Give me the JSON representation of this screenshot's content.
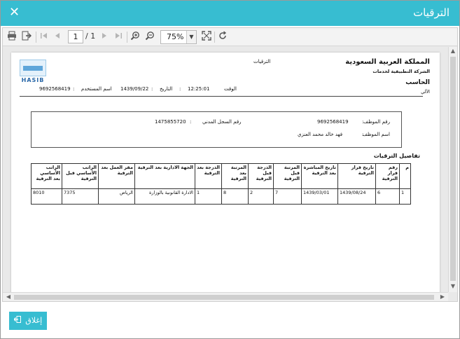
{
  "window": {
    "title": "الترقيات",
    "close_glyph": "✕"
  },
  "toolbar": {
    "print_icon": "print-icon",
    "export_icon": "export-icon",
    "page_current": "1",
    "page_total": "/ 1",
    "zoom": "75%"
  },
  "report": {
    "title": "الترقيات",
    "org_name": "المملكة العربية السعودية",
    "org_sub": "الشركة التطبيقية لخدمات",
    "org_name2": "الحاسب",
    "org_line3": "الآلي",
    "logo_text": "HASIB",
    "time_label": "الوقت",
    "time_value": "12:25:01",
    "date_label": "التاريخ",
    "date_value": "1439/09/22",
    "user_label": "اسم المستخدم",
    "user_value": "9692568419",
    "colon": ":"
  },
  "employee": {
    "emp_no_label": "رقم الموظف",
    "emp_no_value": "9692568419",
    "civil_label": "رقم السجل المدني",
    "civil_value": "1475855720",
    "name_label": "اسم الموظف",
    "name_value": "فهد خالد محمد العنزي"
  },
  "details": {
    "section_title": "تفاصيل الترقيات",
    "headers": [
      "م",
      "رقم قرار الترقية",
      "تاريخ قرار الترقية",
      "تاريخ المباشرة بعد الترقية",
      "المرتبة قبل الترقية",
      "الدرجة قبل الترقية",
      "المرتبة بعد الترقية",
      "الدرجة بعد الترقية",
      "الجهة الادارية بعد الترقية",
      "مقر العمل بعد الترقية",
      "الراتب الأساسي قبل الترقية",
      "الراتب الأساسي بعد الترقية"
    ],
    "rows": [
      [
        "1",
        "6",
        "1439/08/24",
        "1439/03/01",
        "7",
        "2",
        "8",
        "1",
        "الادارة القانونية بالوزارة",
        "الرياض",
        "7375",
        "8010"
      ]
    ]
  },
  "footer": {
    "close_label": "إغلاق"
  }
}
